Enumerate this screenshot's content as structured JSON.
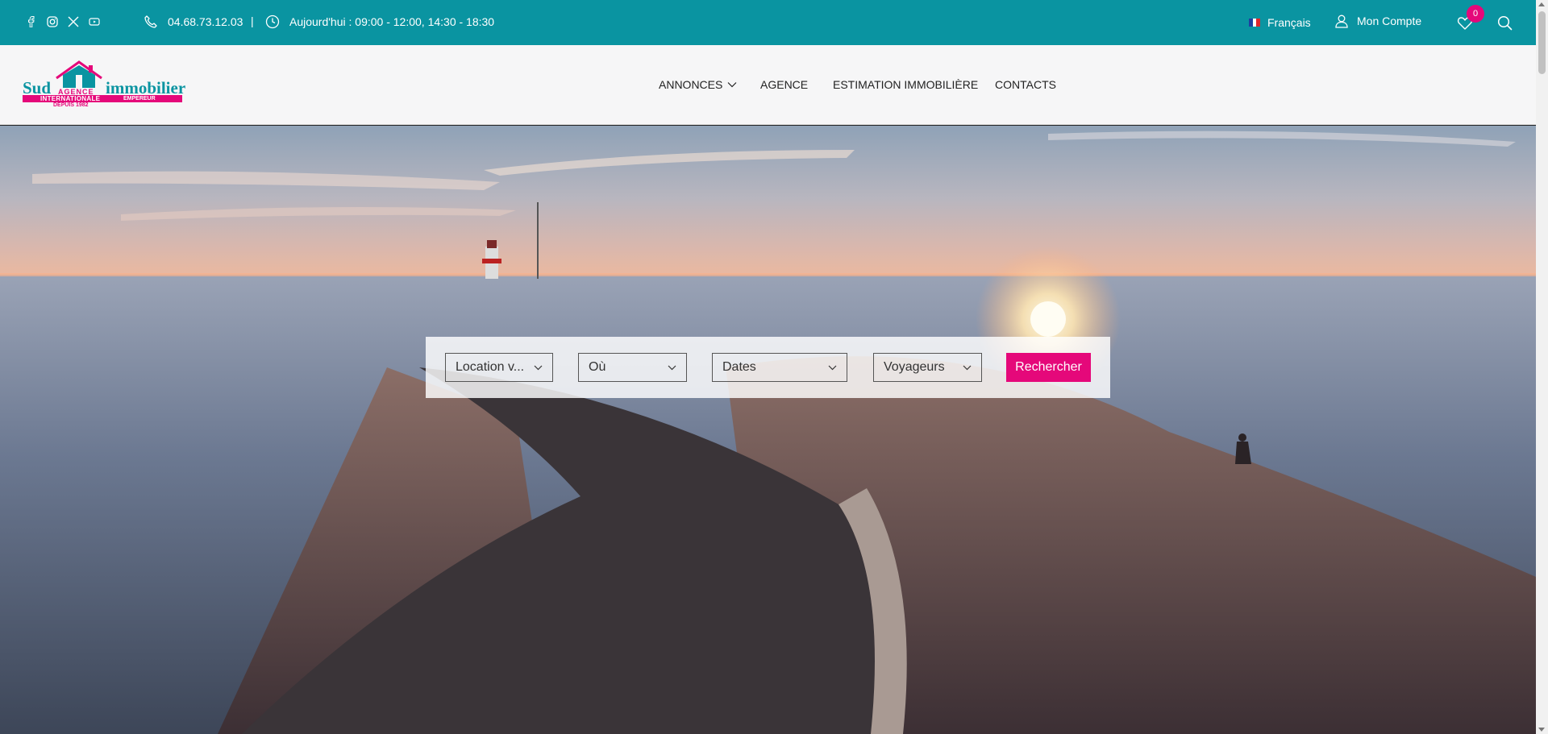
{
  "topbar": {
    "social_icons": [
      "facebook-icon",
      "instagram-icon",
      "x-icon",
      "youtube-icon"
    ],
    "phone": "04.68.73.12.03",
    "separator": "|",
    "hours": "Aujourd'hui : 09:00 - 12:00, 14:30 - 18:30",
    "language": "Français",
    "account": "Mon Compte",
    "wishlist_count": "0"
  },
  "logo": {
    "part1": "Sud",
    "part2": "immobilier",
    "agence": "AGENCE",
    "internationale": "INTERNATIONALE",
    "empereur": "EMPEREUR",
    "depuis": "DEPUIS 1982"
  },
  "nav": {
    "annonces": "ANNONCES",
    "agence": "AGENCE",
    "estimation": "ESTIMATION IMMOBILIÈRE",
    "contacts": "CONTACTS"
  },
  "search": {
    "type": "Location v...",
    "where": "Où",
    "dates": "Dates",
    "guests": "Voyageurs",
    "button": "Rechercher"
  },
  "colors": {
    "brand_teal": "#0a94a1",
    "brand_pink": "#e5087a"
  }
}
